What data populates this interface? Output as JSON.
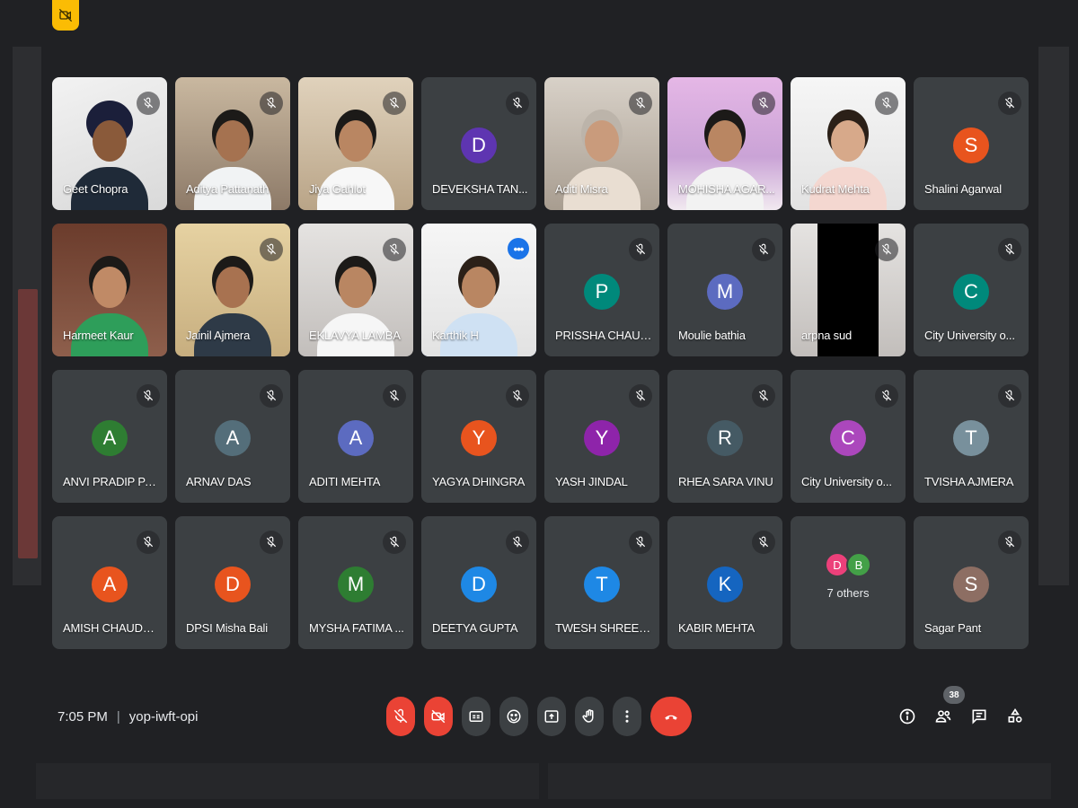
{
  "meeting": {
    "time": "7:05 PM",
    "separator": "|",
    "code": "yop-iwft-opi",
    "participant_count": "38"
  },
  "colors": {
    "background": "#202124",
    "tile": "#3c4043",
    "accent": "#1a73e8",
    "danger": "#ea4335"
  },
  "tiles": [
    {
      "name": "Geet Chopra",
      "type": "video"
    },
    {
      "name": "Aditya Pattanath",
      "type": "video"
    },
    {
      "name": "Jiya Gahlot",
      "type": "video"
    },
    {
      "name": "DEVEKSHA TAN...",
      "type": "avatar",
      "initial": "D",
      "color": "#5e35b1"
    },
    {
      "name": "Aditi Misra",
      "type": "video"
    },
    {
      "name": "MOHISHA AGAR...",
      "type": "video"
    },
    {
      "name": "Kudrat Mehta",
      "type": "video"
    },
    {
      "name": "Shalini Agarwal",
      "type": "avatar",
      "initial": "S",
      "color": "#e8541e"
    },
    {
      "name": "Harmeet Kaur",
      "type": "video"
    },
    {
      "name": "Jainil Ajmera",
      "type": "video"
    },
    {
      "name": "EKLAVYA LAMBA",
      "type": "video"
    },
    {
      "name": "Karthik H",
      "type": "video"
    },
    {
      "name": "PRISSHA CHAUD...",
      "type": "avatar",
      "initial": "P",
      "color": "#00897b"
    },
    {
      "name": "Moulie bathia",
      "type": "avatar",
      "initial": "M",
      "color": "#5c6bc0"
    },
    {
      "name": "arpna sud",
      "type": "video"
    },
    {
      "name": "City University o...",
      "type": "avatar",
      "initial": "C",
      "color": "#00897b"
    },
    {
      "name": "ANVI PRADIP PA...",
      "type": "avatar",
      "initial": "A",
      "color": "#2e7d32"
    },
    {
      "name": "ARNAV DAS",
      "type": "avatar",
      "initial": "A",
      "color": "#546e7a"
    },
    {
      "name": "ADITI MEHTA",
      "type": "avatar",
      "initial": "A",
      "color": "#5c6bc0"
    },
    {
      "name": "YAGYA DHINGRA",
      "type": "avatar",
      "initial": "Y",
      "color": "#e8541e"
    },
    {
      "name": "YASH JINDAL",
      "type": "avatar",
      "initial": "Y",
      "color": "#8e24aa"
    },
    {
      "name": "RHEA SARA VINU",
      "type": "avatar",
      "initial": "R",
      "color": "#455a64"
    },
    {
      "name": "City University o...",
      "type": "avatar",
      "initial": "C",
      "color": "#ab47bc"
    },
    {
      "name": "TVISHA AJMERA",
      "type": "avatar",
      "initial": "T",
      "color": "#78909c"
    },
    {
      "name": "AMISH CHAUDH...",
      "type": "avatar",
      "initial": "A",
      "color": "#e8541e"
    },
    {
      "name": "DPSI Misha Bali",
      "type": "avatar",
      "initial": "D",
      "color": "#e8541e"
    },
    {
      "name": "MYSHA FATIMA ...",
      "type": "avatar",
      "initial": "M",
      "color": "#2e7d32"
    },
    {
      "name": "DEETYA GUPTA",
      "type": "avatar",
      "initial": "D",
      "color": "#1e88e5"
    },
    {
      "name": "TWESH SHREENI...",
      "type": "avatar",
      "initial": "T",
      "color": "#1e88e5"
    },
    {
      "name": "KABIR MEHTA",
      "type": "avatar",
      "initial": "K",
      "color": "#1565c0"
    },
    {
      "name": "7 others",
      "type": "others",
      "initials": [
        "D",
        "B"
      ],
      "colors": [
        "#ec407a",
        "#43a047"
      ]
    },
    {
      "name": "Sagar Pant",
      "type": "avatar",
      "initial": "S",
      "color": "#8d6e63"
    }
  ],
  "icons": {
    "top_badge": "camera-off-icon",
    "muted": "mic-off-icon",
    "more": "more-options-icon",
    "controls": [
      "mic-off-icon",
      "camera-off-icon",
      "captions-icon",
      "emoji-icon",
      "present-icon",
      "raise-hand-icon",
      "more-vert-icon",
      "end-call-icon"
    ],
    "right": [
      "info-icon",
      "people-icon",
      "chat-icon",
      "activities-icon"
    ]
  }
}
